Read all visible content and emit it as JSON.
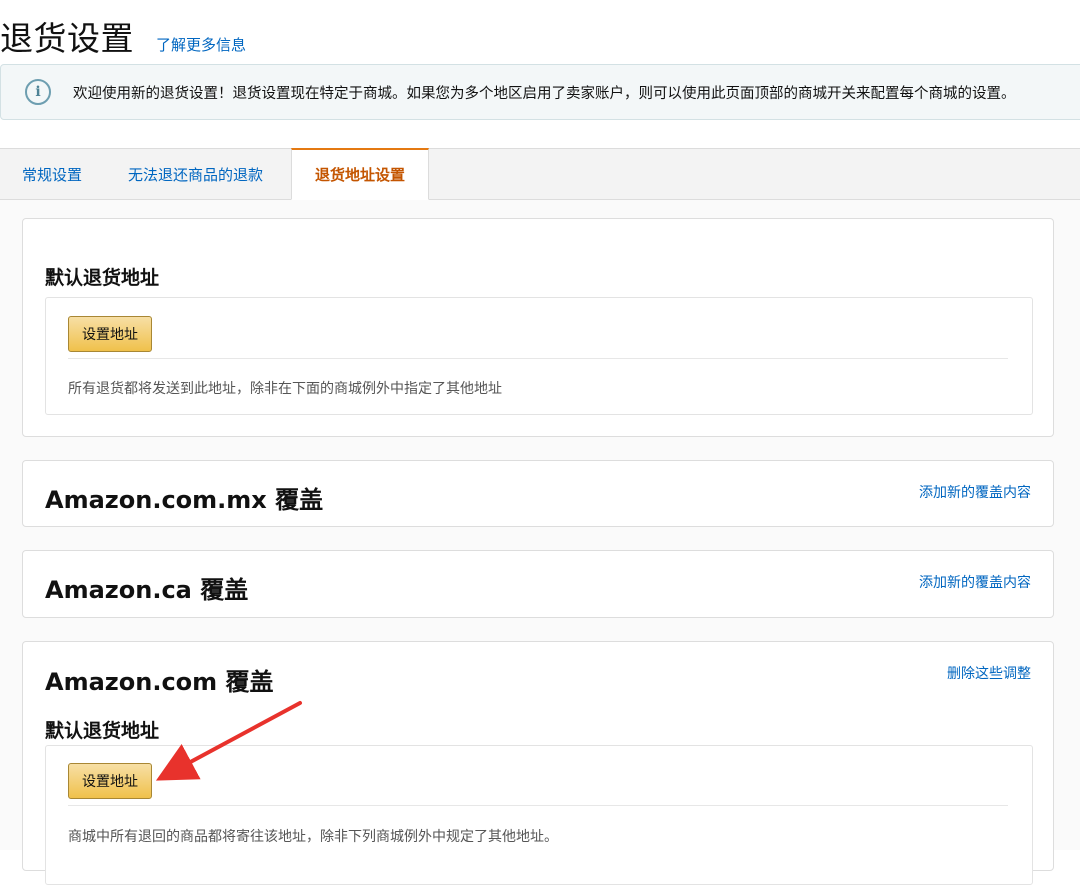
{
  "header": {
    "title": "退货设置",
    "learn_more": "了解更多信息"
  },
  "banner": {
    "icon": "info-icon",
    "icon_glyph": "i",
    "message": "欢迎使用新的退货设置！退货设置现在特定于商城。如果您为多个地区启用了卖家账户，则可以使用此页面顶部的商城开关来配置每个商城的设置。"
  },
  "tabs": [
    {
      "label": "常规设置",
      "active": false
    },
    {
      "label": "无法退还商品的退款",
      "active": false
    },
    {
      "label": "退货地址设置",
      "active": true
    }
  ],
  "default_address": {
    "heading": "默认退货地址",
    "button": "设置地址",
    "helper": "所有退货都将发送到此地址，除非在下面的商城例外中指定了其他地址"
  },
  "overrides": [
    {
      "title": "Amazon.com.mx 覆盖",
      "link": "添加新的覆盖内容"
    },
    {
      "title": "Amazon.ca 覆盖",
      "link": "添加新的覆盖内容"
    },
    {
      "title": "Amazon.com 覆盖",
      "link": "删除这些调整",
      "subheading": "默认退货地址",
      "button": "设置地址",
      "helper": "商城中所有退回的商品都将寄往该地址，除非下列商城例外中规定了其他地址。"
    }
  ],
  "annotation": {
    "arrow_color": "#e8322c"
  },
  "colors": {
    "link": "#0066c0",
    "active_tab": "#c45500",
    "button_gold": "#f0c14b"
  }
}
